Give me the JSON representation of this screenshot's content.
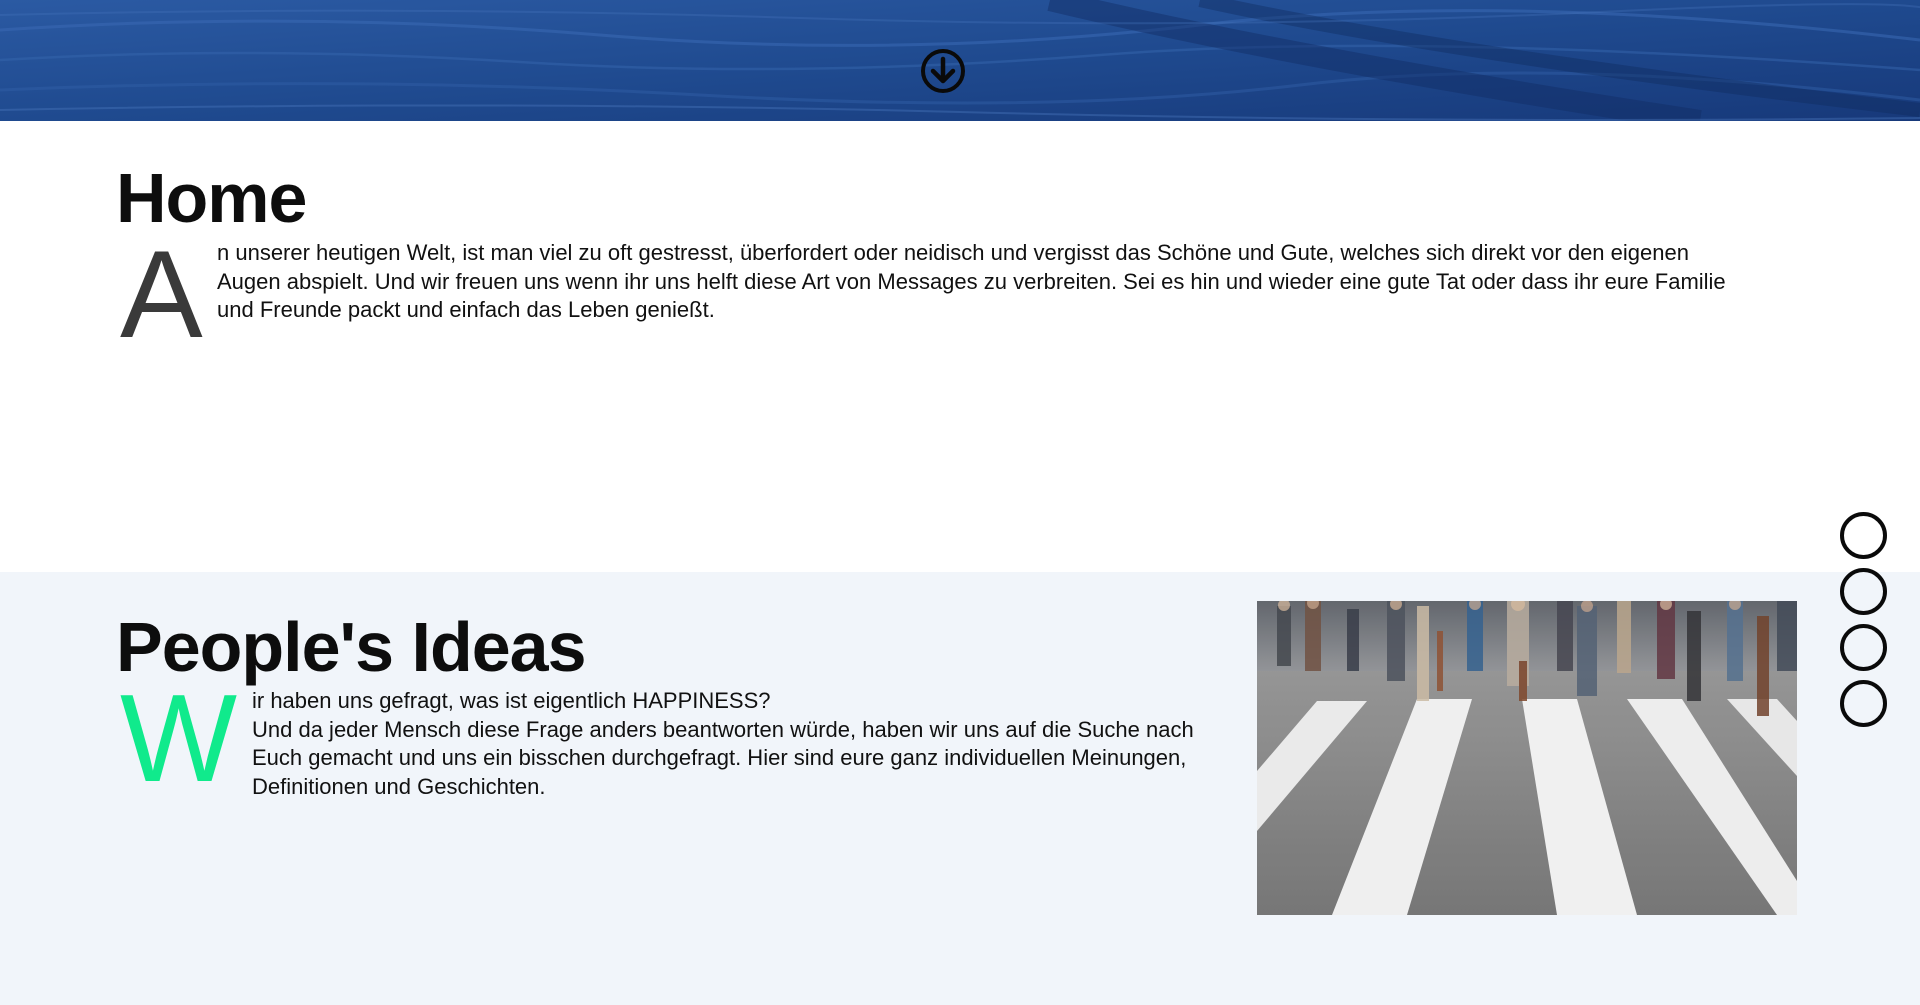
{
  "hero": {
    "scroll_icon": "arrow-down-circle-icon"
  },
  "home": {
    "title": "Home",
    "dropcap": "A",
    "lines": [
      "n unserer heutigen Welt, ist man viel zu oft gestresst, überfordert oder neidisch und vergisst das Schöne und Gute, welches sich direkt vor den eigenen",
      "Augen abspielt. Und wir freuen uns wenn ihr uns helft diese Art von Messages zu verbreiten. Sei es hin und wieder eine gute Tat oder dass ihr eure Familie",
      "und Freunde packt und einfach das Leben genießt."
    ]
  },
  "ideas": {
    "title": "People's Ideas",
    "dropcap": "W",
    "lines": [
      "ir haben uns gefragt, was ist eigentlich HAPPINESS?",
      "Und da jeder Mensch diese Frage anders beantworten würde, haben wir uns auf die Suche nach",
      "Euch gemacht und uns ein bisschen durchgefragt. Hier sind eure ganz individuellen Meinungen,",
      "Definitionen und Geschichten."
    ],
    "photo_icon": "crosswalk-crowd-photo"
  },
  "side_nav": {
    "dots": [
      "nav-dot-1",
      "nav-dot-2",
      "nav-dot-3",
      "nav-dot-4"
    ]
  },
  "colors": {
    "hero_blue": "#25539b",
    "dropcap_green": "#10ea8c",
    "dropcap_gray": "#3a3a3a",
    "ideas_background": "#f1f5fa",
    "text": "#111111"
  }
}
